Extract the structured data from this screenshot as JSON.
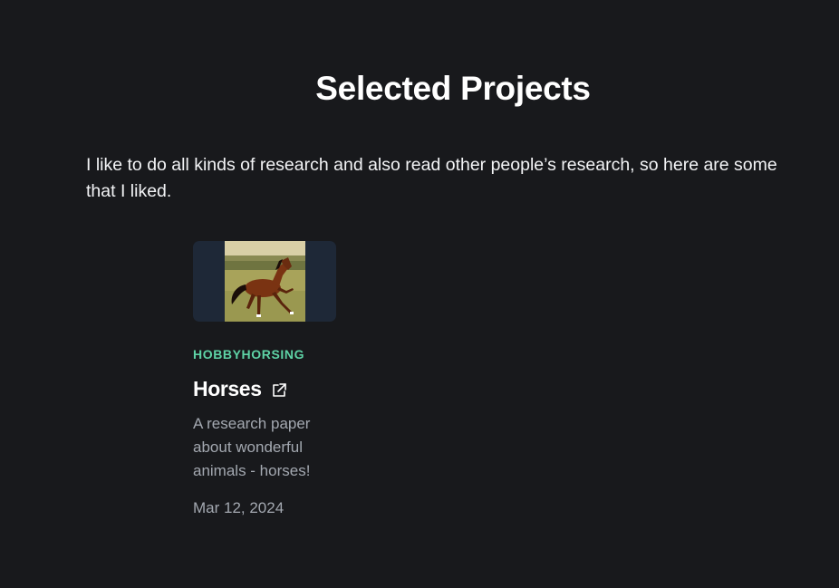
{
  "header": {
    "title": "Selected Projects"
  },
  "intro": {
    "text": "I like to do all kinds of research and also read other people’s research, so here are some that I liked."
  },
  "projects": [
    {
      "category": "HOBBYHORSING",
      "title": "Horses",
      "description": "A research paper about wonderful animals - horses!",
      "date": "Mar 12, 2024",
      "image_icon": "horse-photo",
      "link_icon": "external-link-icon"
    }
  ],
  "colors": {
    "background": "#18191c",
    "card_thumb_bg": "#1e2837",
    "category_accent": "#5ed3a6",
    "muted_text": "#a3a8b0"
  }
}
